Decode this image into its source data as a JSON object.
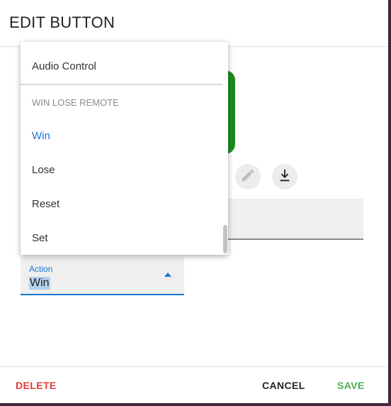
{
  "dialog": {
    "title": "EDIT BUTTON"
  },
  "action_field": {
    "label": "Action",
    "value": "Win"
  },
  "menu": {
    "items": [
      {
        "label": "Audio Control"
      },
      {
        "label": "Win"
      },
      {
        "label": "Lose"
      },
      {
        "label": "Reset"
      },
      {
        "label": "Set"
      }
    ],
    "group_header": "WIN LOSE REMOTE",
    "selected": "Win"
  },
  "footer": {
    "delete_label": "DELETE",
    "cancel_label": "CANCEL",
    "save_label": "SAVE"
  },
  "colors": {
    "accent": "#1976d2",
    "delete": "#e53935",
    "save": "#4caf50",
    "preview": "#1e8c1e"
  },
  "icons": [
    "pencil-icon",
    "download-icon"
  ]
}
